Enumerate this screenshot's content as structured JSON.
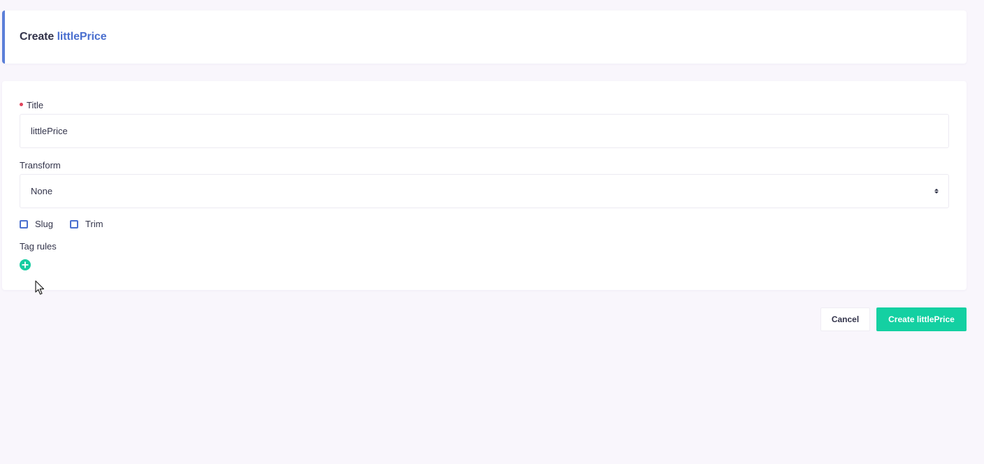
{
  "header": {
    "title_prefix": "Create",
    "title_entity": "littlePrice"
  },
  "form": {
    "title_label": "Title",
    "title_value": "littlePrice",
    "transform_label": "Transform",
    "transform_selected": "None",
    "checkboxes": [
      {
        "label": "Slug",
        "checked": false
      },
      {
        "label": "Trim",
        "checked": false
      }
    ],
    "tag_rules_label": "Tag rules",
    "add_icon": "plus-circle-icon"
  },
  "actions": {
    "cancel_label": "Cancel",
    "create_label": "Create littlePrice"
  },
  "colors": {
    "accent": "#4a6fcf",
    "primary_button": "#14d0a2",
    "add_icon": "#16cca0",
    "required": "#e0435b",
    "background": "#f9f6fc"
  }
}
